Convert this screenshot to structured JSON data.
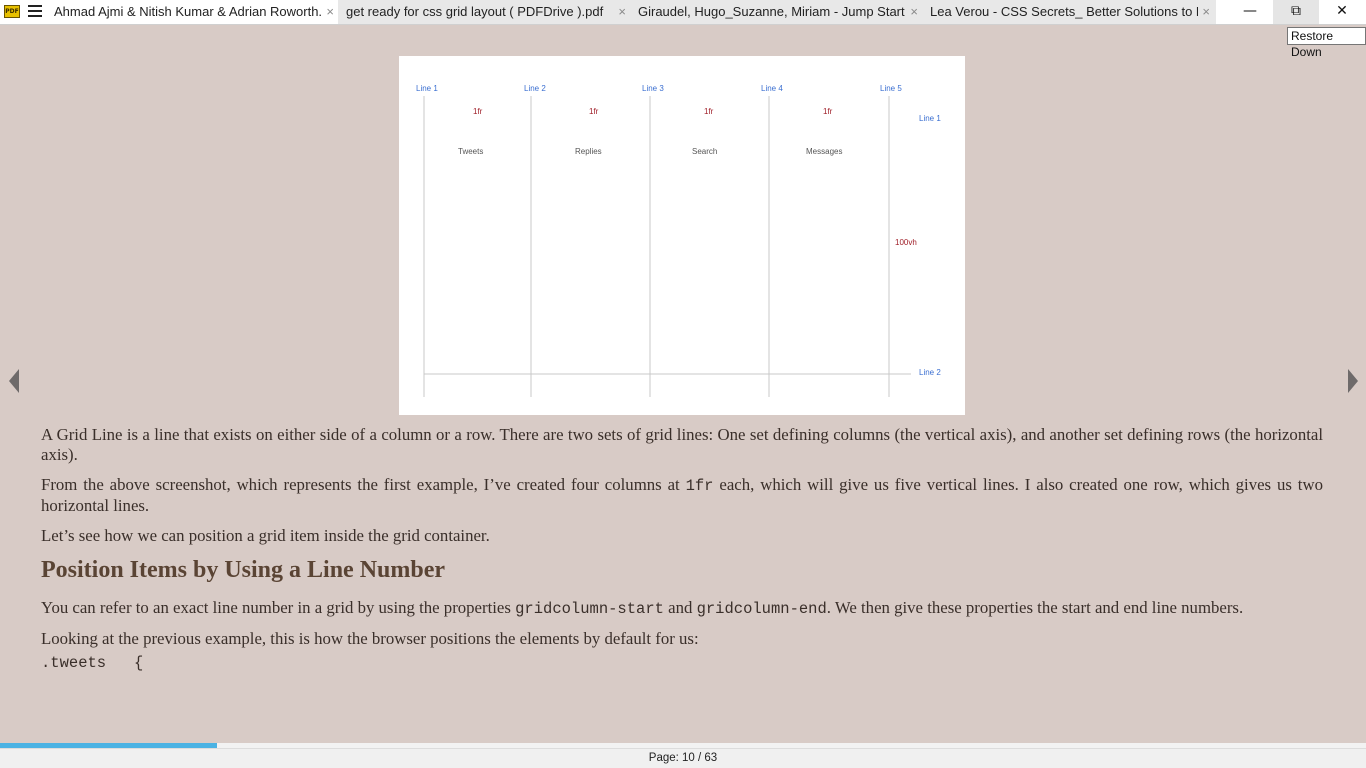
{
  "app": {
    "logo_text": "PDF"
  },
  "tabs": [
    {
      "label": "Ahmad Ajmi & Nitish Kumar & Adrian Roworth...",
      "close": "×",
      "active": true
    },
    {
      "label": "get ready for css grid layout ( PDFDrive ).pdf",
      "close": "×",
      "active": false
    },
    {
      "label": "Giraudel, Hugo_Suzanne, Miriam - Jump Start S...",
      "close": "×",
      "active": false
    },
    {
      "label": "Lea Verou - CSS Secrets_ Better Solutions to Ev...",
      "close": "×",
      "active": false
    }
  ],
  "window": {
    "minimize": "—",
    "restore": "⧉",
    "close": "✕",
    "tooltip": "Restore Down"
  },
  "figure": {
    "column_lines": [
      "Line 1",
      "Line 2",
      "Line 3",
      "Line 4",
      "Line 5"
    ],
    "fr_labels": [
      "1fr",
      "1fr",
      "1fr",
      "1fr"
    ],
    "items": [
      "Tweets",
      "Replies",
      "Search",
      "Messages"
    ],
    "row_lines": [
      "Line 1",
      "Line 2"
    ],
    "row_size": "100vh",
    "colors": {
      "line_label": "#3b6fd1",
      "fr_label": "#a0202a",
      "grid_line": "#c8c8c8"
    }
  },
  "content": {
    "p1": "A Grid Line is a line that exists on either side of a column or a row. There are two sets of grid lines: One set defining columns (the vertical axis), and another set  defining rows (the horizontal axis).",
    "p2_a": "From the above screenshot, which represents the first example, I’ve created four columns at ",
    "p2_code": "1fr",
    "p2_b": " each, which will give us five vertical lines. I also created one row,  which gives us two horizontal lines.",
    "p3": "Let’s see how we can position a grid item inside the grid container.",
    "heading": "Position Items by Using a Line Number",
    "p4_a": "You can refer to an exact line number in a grid by using the properties ",
    "p4_code1": "gridcolumn-start",
    "p4_mid": " and ",
    "p4_code2": "gridcolumn-end",
    "p4_b": ". We then give these properties the start and end  line numbers.",
    "p5": "Looking at the previous example, this is how the browser positions the elements by default for us:",
    "code": ".tweets   {"
  },
  "status": {
    "page_label": "Page: 10 / 63",
    "progress": 0.1587
  },
  "colors": {
    "background": "#d8cbc6",
    "heading": "#5a4434",
    "progress": "#4ab2e3"
  }
}
